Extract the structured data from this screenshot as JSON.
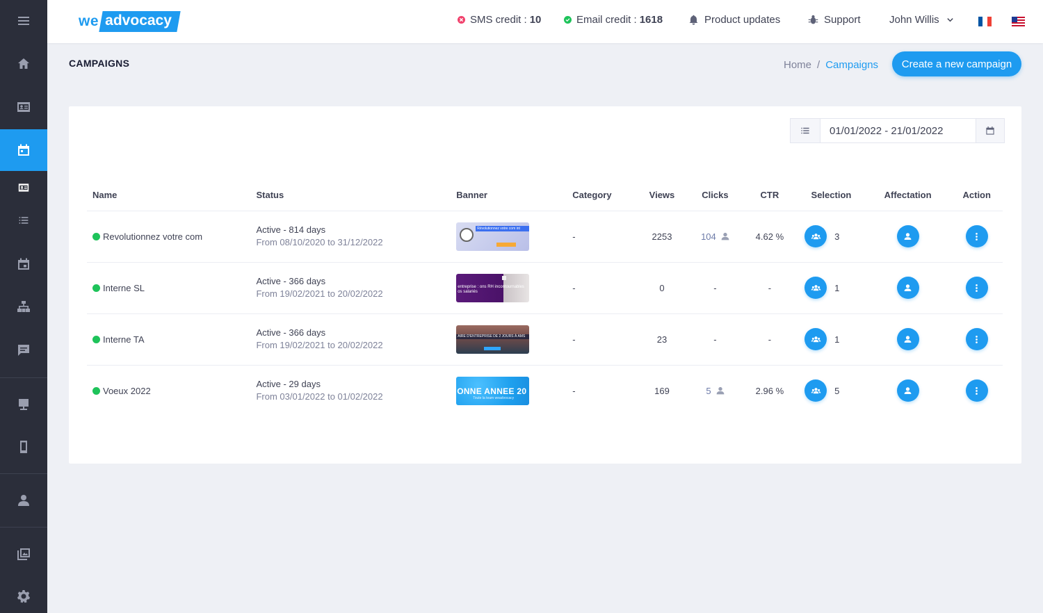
{
  "header": {
    "logo_we": "we",
    "logo_adv": "advocacy",
    "sms_label": "SMS credit :",
    "sms_value": "10",
    "email_label": "Email credit :",
    "email_value": "1618",
    "product_updates": "Product updates",
    "support": "Support",
    "user_name": "John Willis"
  },
  "toolbar": {
    "page_title": "CAMPAIGNS",
    "breadcrumb_home": "Home",
    "breadcrumb_sep": "/",
    "breadcrumb_current": "Campaigns",
    "create_label": "Create a new campaign"
  },
  "filter": {
    "date_range": "01/01/2022 - 21/01/2022"
  },
  "table": {
    "headers": {
      "name": "Name",
      "status": "Status",
      "banner": "Banner",
      "category": "Category",
      "views": "Views",
      "clicks": "Clicks",
      "ctr": "CTR",
      "selection": "Selection",
      "affectation": "Affectation",
      "action": "Action"
    },
    "rows": [
      {
        "name": "Revolutionnez votre com",
        "status": "Active - 814 days",
        "period": "From 08/10/2020 to 31/12/2022",
        "banner_text": "Révolutionnez votre com int",
        "category": "-",
        "views": "2253",
        "clicks": "104",
        "ctr": "4.62 %",
        "selection": "3"
      },
      {
        "name": "Interne SL",
        "status": "Active - 366 days",
        "period": "From 19/02/2021 to 20/02/2022",
        "banner_text": "entreprise : ons RH incontournables os salariés",
        "category": "-",
        "views": "0",
        "clicks": "-",
        "ctr": "-",
        "selection": "1"
      },
      {
        "name": "Interne TA",
        "status": "Active - 366 days",
        "period": "From 19/02/2021 to 20/02/2022",
        "banner_text": "AIRE D'ENTREPRISE DE 2 JOURS À AMS",
        "category": "-",
        "views": "23",
        "clicks": "-",
        "ctr": "-",
        "selection": "1"
      },
      {
        "name": "Voeux 2022",
        "status": "Active - 29 days",
        "period": "From 03/01/2022 to 01/02/2022",
        "banner_text": "ONNE ANNEE 20",
        "banner_sub": "Toute la team weadvocacy",
        "category": "-",
        "views": "169",
        "clicks": "5",
        "ctr": "2.96 %",
        "selection": "5"
      }
    ]
  },
  "colors": {
    "accent": "#1e9bf0",
    "sidebar": "#2b2e3a",
    "active_status": "#1ec35a",
    "sms_indicator": "#f1416c"
  }
}
